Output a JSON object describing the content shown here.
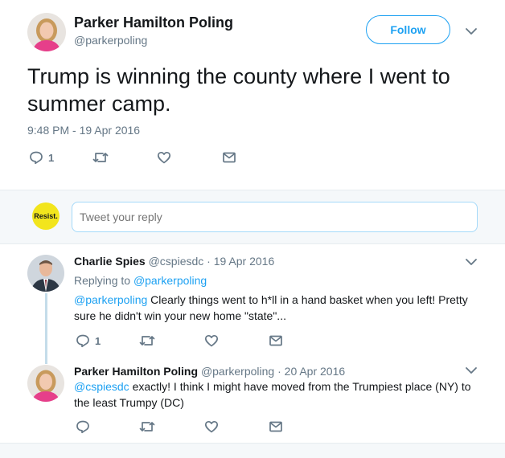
{
  "tweet": {
    "author_name": "Parker Hamilton Poling",
    "author_handle": "@parkerpoling",
    "follow_label": "Follow",
    "text": "Trump is winning the county where I went to summer camp.",
    "timestamp": "9:48 PM - 19 Apr 2016",
    "reply_count": "1",
    "icons": [
      "reply-icon",
      "retweet-icon",
      "like-icon",
      "message-icon",
      "chevron-down-icon"
    ]
  },
  "composer": {
    "badge_text": "Resist.",
    "placeholder": "Tweet your reply"
  },
  "replies": [
    {
      "author_name": "Charlie Spies",
      "author_handle": "@cspiesdc",
      "date": "19 Apr 2016",
      "replying_label": "Replying to",
      "replying_to": "@parkerpoling",
      "mention": "@parkerpoling",
      "text_line1": " Clearly things went to h*ll in a hand basket when you left!  Pretty",
      "text_line2": "sure he didn't win your new home \"state\"...",
      "reply_count": "1"
    },
    {
      "author_name": "Parker Hamilton Poling",
      "author_handle": "@parkerpoling",
      "date": "20 Apr 2016",
      "mention": "@cspiesdc",
      "text_line1": " exactly! I think I might have moved from the Trumpiest place (NY) to",
      "text_line2": "the least Trumpy (DC)",
      "reply_count": ""
    }
  ],
  "colors": {
    "accent": "#1da1f2",
    "muted": "#657786",
    "badge": "#f2e51d"
  }
}
